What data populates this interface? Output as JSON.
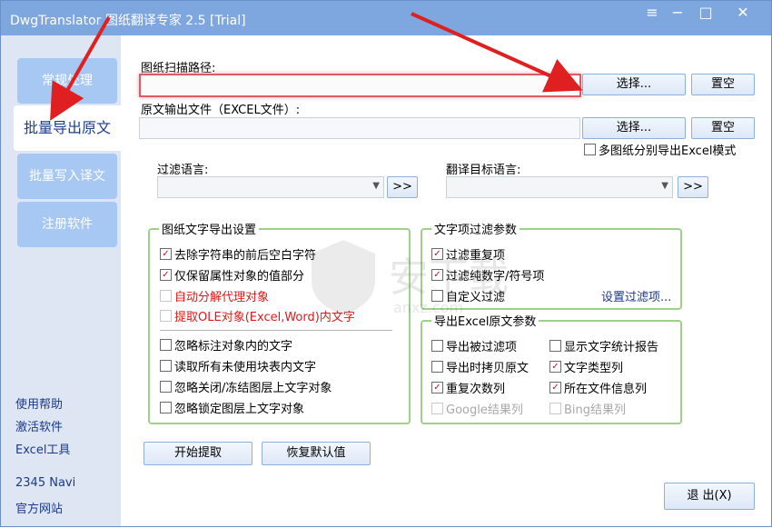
{
  "window": {
    "title": "DwgTranslator 图纸翻译专家 2.5 [Trial]"
  },
  "titlebar_icons": [
    "menu-icon",
    "minimize-icon",
    "maximize-icon",
    "close-icon"
  ],
  "sidebar": {
    "nav": [
      {
        "label": "常规处理"
      },
      {
        "label": "批量导出原文"
      },
      {
        "label": "批量写入译文"
      },
      {
        "label": "注册软件"
      }
    ],
    "links": [
      "使用帮助",
      "激活软件",
      "Excel工具",
      "2345 Navi",
      "官方网站"
    ]
  },
  "main": {
    "scan_path_label": "图纸扫描路径:",
    "scan_path_value": "",
    "output_file_label": "原文输出文件（EXCEL文件）:",
    "output_file_value": "",
    "select_label": "选择...",
    "clear_label": "置空",
    "multi_export_label": "多图纸分别导出Excel模式",
    "filter_lang_label": "过滤语言:",
    "filter_lang_value": "",
    "target_lang_label": "翻译目标语言:",
    "target_lang_value": "",
    "expand_label": ">>",
    "export_settings": {
      "title": "图纸文字导出设置",
      "options": [
        {
          "label": "去除字符串的前后空白字符",
          "checked": true,
          "style": "normal"
        },
        {
          "label": "仅保留属性对象的值部分",
          "checked": true,
          "style": "normal"
        },
        {
          "label": "自动分解代理对象",
          "checked": false,
          "style": "red-disabled"
        },
        {
          "label": "提取OLE对象(Excel,Word)内文字",
          "checked": false,
          "style": "red-disabled"
        },
        {
          "label": "忽略标注对象内的文字",
          "checked": false,
          "style": "normal"
        },
        {
          "label": "读取所有未使用块表内文字",
          "checked": false,
          "style": "normal"
        },
        {
          "label": "忽略关闭/冻结图层上文字对象",
          "checked": false,
          "style": "normal"
        },
        {
          "label": "忽略锁定图层上文字对象",
          "checked": false,
          "style": "normal"
        }
      ]
    },
    "text_filter": {
      "title": "文字项过滤参数",
      "options": [
        {
          "label": "过滤重复项",
          "checked": true
        },
        {
          "label": "过滤纯数字/符号项",
          "checked": true
        },
        {
          "label": "自定义过滤",
          "checked": false
        }
      ],
      "set_filter_link": "设置过滤项..."
    },
    "excel_params": {
      "title": "导出Excel原文参数",
      "left": [
        {
          "label": "导出被过滤项",
          "checked": false,
          "disabled": false
        },
        {
          "label": "导出时拷贝原文",
          "checked": false,
          "disabled": false
        },
        {
          "label": "重复次数列",
          "checked": true,
          "disabled": false
        },
        {
          "label": "Google结果列",
          "checked": false,
          "disabled": true
        }
      ],
      "right": [
        {
          "label": "显示文字统计报告",
          "checked": false,
          "disabled": false
        },
        {
          "label": "文字类型列",
          "checked": true,
          "disabled": false
        },
        {
          "label": "所在文件信息列",
          "checked": true,
          "disabled": false
        },
        {
          "label": "Bing结果列",
          "checked": false,
          "disabled": true
        }
      ]
    },
    "start_label": "开始提取",
    "reset_label": "恢复默认值",
    "exit_label": "退 出(X)"
  },
  "watermark": {
    "text": "安下载",
    "sub": "anxz.com"
  },
  "colors": {
    "titlebar": "#7ea6df",
    "nav": "#a7c8f2",
    "group_border": "#9ed08a",
    "annotation_arrow": "#e02020"
  }
}
